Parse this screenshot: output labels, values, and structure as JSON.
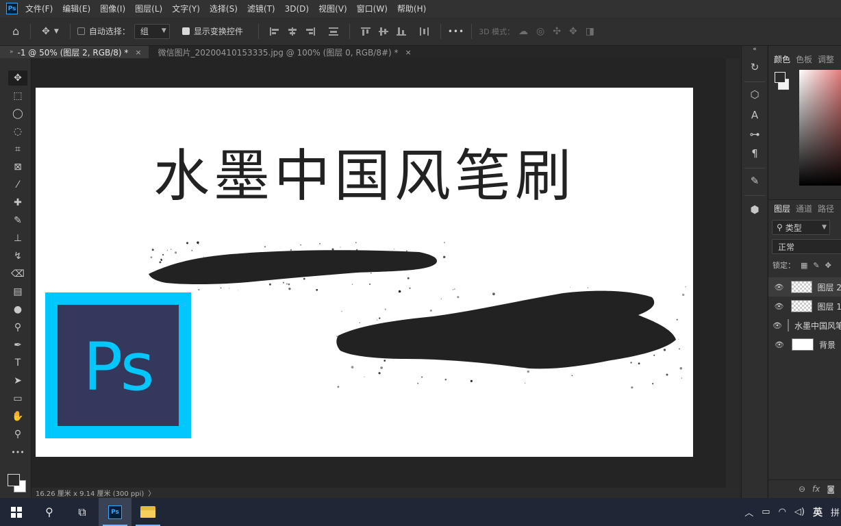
{
  "app": {
    "logo_text": "Ps"
  },
  "menu": [
    "文件(F)",
    "编辑(E)",
    "图像(I)",
    "图层(L)",
    "文字(Y)",
    "选择(S)",
    "滤镜(T)",
    "3D(D)",
    "视图(V)",
    "窗口(W)",
    "帮助(H)"
  ],
  "options": {
    "auto_select_label": "自动选择：",
    "auto_select_checked": false,
    "auto_select_target": "组",
    "show_transform_label": "显示变换控件",
    "show_transform_checked": true,
    "more_label": "•••",
    "mode_3d_label": "3D 模式："
  },
  "tabs": [
    {
      "label": "-1 @ 50% (图层 2, RGB/8) *",
      "active": true
    },
    {
      "label": "微信图片_20200410153335.jpg @ 100% (图层 0, RGB/8#) *",
      "active": false
    }
  ],
  "tab_close_glyph": "×",
  "toolbox": {
    "icons": [
      "move-tool-icon",
      "marquee-tool-icon",
      "lasso-tool-icon",
      "quick-select-tool-icon",
      "crop-tool-icon",
      "frame-tool-icon",
      "eyedropper-tool-icon",
      "healing-brush-tool-icon",
      "brush-tool-icon",
      "clone-stamp-tool-icon",
      "history-brush-tool-icon",
      "eraser-tool-icon",
      "gradient-tool-icon",
      "blur-tool-icon",
      "dodge-tool-icon",
      "pen-tool-icon",
      "type-tool-icon",
      "path-select-tool-icon",
      "rectangle-tool-icon",
      "hand-tool-icon",
      "zoom-tool-icon",
      "more-tools-icon"
    ]
  },
  "canvas": {
    "title_text": "水墨中国风笔刷",
    "ps_logo_text": "Ps",
    "ink_color": "#222222",
    "logo_frame_color": "#00c8ff",
    "logo_fill_color": "#34385c"
  },
  "status": {
    "doc_size": "16.26 厘米 x 9.14 厘米 (300 ppi)",
    "arrow": "〉"
  },
  "right_panel": {
    "color_tabs": [
      "颜色",
      "色板",
      "调整"
    ],
    "layer_tabs": [
      "图层",
      "通道",
      "路径"
    ],
    "filter_label": "类型",
    "blend_mode": "正常",
    "lock_label": "锁定：",
    "footer_fx": "fx",
    "layers": [
      {
        "name": "图层 2",
        "selected": true,
        "thumb": "checker"
      },
      {
        "name": "图层 1",
        "selected": false,
        "thumb": "checker"
      },
      {
        "name": "水墨中国风笔刷",
        "selected": false,
        "thumb": "checker"
      },
      {
        "name": "背景",
        "selected": false,
        "thumb": "plain"
      }
    ]
  },
  "taskbar": {
    "ps_text": "Ps",
    "ime_text": "英",
    "ime_extra": "拼"
  }
}
